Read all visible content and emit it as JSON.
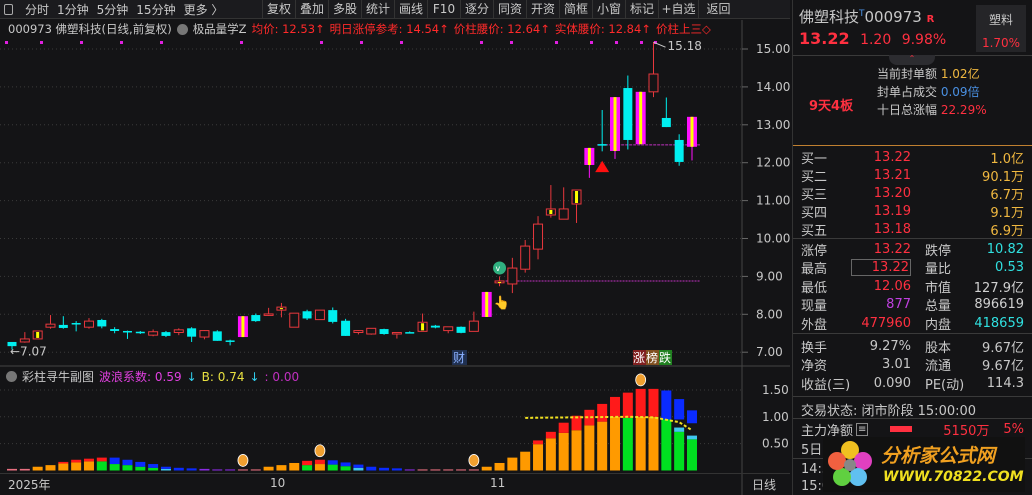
{
  "toolbar": {
    "left": [
      "分时",
      "1分钟",
      "5分钟",
      "15分钟",
      "更多 〉"
    ],
    "buttons": [
      "复权",
      "叠加",
      "多股",
      "统计",
      "画线",
      "F10",
      "逐分",
      "同资",
      "开资",
      "简框",
      "小窗",
      "标记",
      "+自选",
      "返回"
    ]
  },
  "info": {
    "title": "000973 佛塑科技(日线,前复权)",
    "indicator": "极品量学Z",
    "items": [
      "均价: 12.53↑",
      "明日涨停参考: 14.54↑",
      "价柱腰价: 12.64↑",
      "实体腰价: 12.84↑",
      "价柱上三◇"
    ]
  },
  "chart": {
    "price_ticks": [
      "15.00",
      "14.00",
      "13.00",
      "12.00",
      "11.00",
      "10.00",
      "9.00",
      "8.00",
      "7.00"
    ],
    "high_label": "15.18",
    "low_label": "←7.07",
    "tag_cai": "财",
    "tags": [
      "涨",
      "榜",
      "跌"
    ],
    "candles": [
      [
        7.27,
        7.27,
        7.07,
        7.16,
        "c"
      ],
      [
        7.27,
        7.53,
        7.25,
        7.35,
        "r"
      ],
      [
        7.35,
        7.56,
        7.35,
        7.56,
        "y"
      ],
      [
        7.66,
        7.98,
        7.62,
        7.74,
        "r"
      ],
      [
        7.72,
        7.95,
        7.62,
        7.64,
        "c"
      ],
      [
        7.77,
        7.82,
        7.55,
        7.76,
        "c"
      ],
      [
        7.66,
        7.9,
        7.62,
        7.82,
        "r"
      ],
      [
        7.85,
        7.88,
        7.63,
        7.68,
        "c"
      ],
      [
        7.61,
        7.66,
        7.5,
        7.56,
        "c"
      ],
      [
        7.56,
        7.57,
        7.35,
        7.55,
        "c"
      ],
      [
        7.54,
        7.56,
        7.48,
        7.5,
        "c"
      ],
      [
        7.45,
        7.6,
        7.42,
        7.54,
        "r"
      ],
      [
        7.53,
        7.56,
        7.4,
        7.43,
        "c"
      ],
      [
        7.52,
        7.63,
        7.45,
        7.59,
        "r"
      ],
      [
        7.63,
        7.66,
        7.27,
        7.41,
        "c"
      ],
      [
        7.4,
        7.58,
        7.34,
        7.57,
        "r"
      ],
      [
        7.55,
        7.58,
        7.3,
        7.3,
        "c"
      ],
      [
        7.31,
        7.33,
        7.18,
        7.28,
        "c"
      ],
      [
        7.4,
        7.95,
        7.4,
        7.95,
        "p"
      ],
      [
        7.98,
        8.02,
        7.8,
        7.82,
        "c"
      ],
      [
        7.98,
        8.17,
        7.96,
        8.01,
        "r"
      ],
      [
        8.11,
        8.3,
        7.92,
        8.19,
        "y"
      ],
      [
        7.66,
        8.03,
        7.66,
        8.03,
        "r"
      ],
      [
        8.08,
        8.12,
        7.85,
        7.89,
        "c"
      ],
      [
        7.86,
        8.11,
        7.86,
        8.11,
        "r"
      ],
      [
        8.11,
        8.18,
        7.76,
        7.8,
        "c"
      ],
      [
        7.83,
        7.88,
        7.43,
        7.43,
        "c"
      ],
      [
        7.52,
        7.58,
        7.47,
        7.57,
        "r"
      ],
      [
        7.48,
        7.63,
        7.46,
        7.63,
        "r"
      ],
      [
        7.61,
        7.62,
        7.46,
        7.48,
        "c"
      ],
      [
        7.48,
        7.52,
        7.36,
        7.52,
        "r"
      ],
      [
        7.53,
        7.55,
        7.51,
        7.53,
        "c"
      ],
      [
        7.55,
        8.02,
        7.55,
        7.79,
        "y"
      ],
      [
        7.7,
        7.72,
        7.63,
        7.65,
        "c"
      ],
      [
        7.57,
        7.67,
        7.5,
        7.67,
        "r"
      ],
      [
        7.67,
        7.68,
        7.5,
        7.51,
        "c"
      ],
      [
        7.55,
        8.07,
        7.55,
        7.82,
        "r"
      ],
      [
        7.93,
        8.59,
        7.93,
        8.59,
        "p"
      ],
      [
        8.83,
        9.0,
        8.74,
        8.88,
        "y"
      ],
      [
        8.8,
        9.49,
        8.56,
        9.22,
        "r"
      ],
      [
        9.19,
        9.96,
        9.1,
        9.8,
        "r"
      ],
      [
        9.72,
        10.59,
        9.45,
        10.38,
        "r"
      ],
      [
        10.62,
        11.41,
        10.55,
        10.78,
        "y"
      ],
      [
        10.51,
        11.35,
        10.51,
        10.78,
        "r"
      ],
      [
        10.91,
        11.28,
        10.41,
        11.28,
        "y"
      ],
      [
        11.94,
        12.39,
        11.6,
        12.39,
        "p"
      ],
      [
        12.49,
        13.39,
        12.3,
        12.49,
        "c"
      ],
      [
        12.31,
        13.73,
        12.1,
        13.73,
        "p"
      ],
      [
        13.97,
        14.3,
        12.35,
        12.6,
        "c"
      ],
      [
        12.49,
        13.87,
        12.49,
        13.87,
        "p"
      ],
      [
        13.87,
        15.18,
        13.73,
        14.34,
        "r"
      ],
      [
        13.18,
        13.72,
        12.94,
        12.94,
        "c"
      ],
      [
        12.6,
        12.75,
        11.92,
        12.02,
        "c"
      ],
      [
        12.42,
        13.21,
        12.06,
        13.21,
        "p"
      ]
    ],
    "line_levels": [
      8.88,
      12.47
    ]
  },
  "sub": {
    "title": "彩柱寻牛副图",
    "wave_label": "波浪系数: 0.59",
    "b_label": "B: 0.74",
    "c_label": ": 0.00",
    "ticks": [
      "1.50",
      "1.00",
      "0.50"
    ],
    "colors": {
      "o": "#ff9a00",
      "r": "#ff1a1a",
      "g": "#00e020",
      "b": "#0a2bff",
      "p": "#e87080",
      "u": "#8a2be2",
      "c": "#40c8f0"
    },
    "bars": [
      [
        [
          0,
          0.03,
          "p"
        ]
      ],
      [
        [
          0,
          0.03,
          "p"
        ]
      ],
      [
        [
          0,
          0.07,
          "o"
        ]
      ],
      [
        [
          0,
          0.1,
          "o"
        ]
      ],
      [
        [
          0,
          0.13,
          "o"
        ],
        [
          0.13,
          0.16,
          "r"
        ]
      ],
      [
        [
          0,
          0.15,
          "o"
        ],
        [
          0.15,
          0.2,
          "r"
        ]
      ],
      [
        [
          0,
          0.17,
          "o"
        ],
        [
          0.17,
          0.22,
          "r"
        ]
      ],
      [
        [
          0,
          0.17,
          "g"
        ],
        [
          0.17,
          0.24,
          "r"
        ]
      ],
      [
        [
          0,
          0.12,
          "g"
        ],
        [
          0.12,
          0.24,
          "b"
        ]
      ],
      [
        [
          0,
          0.1,
          "g"
        ],
        [
          0.1,
          0.2,
          "b"
        ]
      ],
      [
        [
          0,
          0.07,
          "g"
        ],
        [
          0.07,
          0.16,
          "b"
        ]
      ],
      [
        [
          0,
          0.05,
          "g"
        ],
        [
          0.05,
          0.12,
          "b"
        ]
      ],
      [
        [
          0,
          0.03,
          "c"
        ],
        [
          0.03,
          0.07,
          "b"
        ]
      ],
      [
        [
          0,
          0.05,
          "b"
        ]
      ],
      [
        [
          0,
          0.04,
          "b"
        ]
      ],
      [
        [
          0,
          0.03,
          "u"
        ]
      ],
      [
        [
          0,
          0.02,
          "u"
        ]
      ],
      [
        [
          0,
          0.02,
          "u"
        ]
      ],
      [
        [
          0,
          0.02,
          "p"
        ]
      ],
      [
        [
          0,
          0.02,
          "p"
        ]
      ],
      [
        [
          0,
          0.07,
          "o"
        ]
      ],
      [
        [
          0,
          0.1,
          "o"
        ]
      ],
      [
        [
          0,
          0.14,
          "o"
        ]
      ],
      [
        [
          0,
          0.1,
          "g"
        ],
        [
          0.1,
          0.18,
          "r"
        ]
      ],
      [
        [
          0,
          0.12,
          "o"
        ],
        [
          0.12,
          0.2,
          "r"
        ]
      ],
      [
        [
          0,
          0.11,
          "g"
        ],
        [
          0.11,
          0.19,
          "b"
        ]
      ],
      [
        [
          0,
          0.08,
          "g"
        ],
        [
          0.08,
          0.15,
          "b"
        ]
      ],
      [
        [
          0,
          0.05,
          "c"
        ],
        [
          0.05,
          0.11,
          "b"
        ]
      ],
      [
        [
          0,
          0.07,
          "b"
        ]
      ],
      [
        [
          0,
          0.05,
          "b"
        ]
      ],
      [
        [
          0,
          0.04,
          "b"
        ]
      ],
      [
        [
          0,
          0.02,
          "u"
        ]
      ],
      [
        [
          0,
          0.02,
          "p"
        ]
      ],
      [
        [
          0,
          0.02,
          "p"
        ]
      ],
      [
        [
          0,
          0.02,
          "p"
        ]
      ],
      [
        [
          0,
          0.02,
          "p"
        ]
      ],
      [
        [
          0,
          0.02,
          "p"
        ]
      ],
      [
        [
          0,
          0.07,
          "o"
        ]
      ],
      [
        [
          0,
          0.14,
          "o"
        ]
      ],
      [
        [
          0,
          0.24,
          "o"
        ]
      ],
      [
        [
          0,
          0.35,
          "o"
        ]
      ],
      [
        [
          0,
          0.49,
          "o"
        ],
        [
          0.49,
          0.56,
          "r"
        ]
      ],
      [
        [
          0,
          0.6,
          "o"
        ],
        [
          0.6,
          0.72,
          "r"
        ]
      ],
      [
        [
          0,
          0.7,
          "o"
        ],
        [
          0.7,
          0.89,
          "r"
        ]
      ],
      [
        [
          0,
          0.75,
          "o"
        ],
        [
          0.75,
          1.02,
          "r"
        ]
      ],
      [
        [
          0,
          0.84,
          "o"
        ],
        [
          0.84,
          1.13,
          "r"
        ]
      ],
      [
        [
          0,
          0.91,
          "o"
        ],
        [
          0.91,
          1.24,
          "r"
        ]
      ],
      [
        [
          0,
          1.0,
          "o"
        ],
        [
          1.0,
          1.37,
          "r"
        ]
      ],
      [
        [
          0,
          0.98,
          "g"
        ],
        [
          0.98,
          1.45,
          "r"
        ]
      ],
      [
        [
          0,
          1.0,
          "o"
        ],
        [
          1.0,
          1.52,
          "r"
        ]
      ],
      [
        [
          0,
          1.0,
          "o"
        ],
        [
          1.0,
          1.52,
          "r"
        ]
      ],
      [
        [
          0,
          0.95,
          "g"
        ],
        [
          0.95,
          1.49,
          "b"
        ]
      ],
      [
        [
          0,
          0.72,
          "g"
        ],
        [
          0.72,
          0.8,
          "c"
        ],
        [
          0.95,
          1.33,
          "b"
        ]
      ],
      [
        [
          0,
          0.58,
          "g"
        ],
        [
          0.58,
          0.65,
          "c"
        ],
        [
          0.88,
          1.12,
          "b"
        ]
      ]
    ],
    "moneybags": [
      18,
      24,
      36,
      49
    ]
  },
  "xaxis": {
    "labels": [
      "2025年",
      "10",
      "11"
    ],
    "right": "日线"
  },
  "quote": {
    "name": "佛塑科技",
    "t": "T",
    "code": "000973",
    "r": "R",
    "price": "13.22",
    "change": "1.20",
    "pct": "9.98%",
    "sector": "塑料",
    "sector_pct": "1.70%",
    "streak": "9天4板",
    "info": [
      {
        "label": "当前封单额",
        "value": "1.02亿"
      },
      {
        "label": "封单占成交",
        "value": "0.09倍"
      },
      {
        "label": "十日总涨幅",
        "value": "22.29%"
      }
    ],
    "book": [
      {
        "label": "买一",
        "price": "13.22",
        "vol": "1.0亿"
      },
      {
        "label": "买二",
        "price": "13.21",
        "vol": "90.1万"
      },
      {
        "label": "买三",
        "price": "13.20",
        "vol": "6.7万"
      },
      {
        "label": "买四",
        "price": "13.19",
        "vol": "9.1万"
      },
      {
        "label": "买五",
        "price": "13.18",
        "vol": "6.9万"
      }
    ],
    "stats": [
      [
        "涨停",
        "13.22",
        "跌停",
        "10.82"
      ],
      [
        "最高",
        "13.22",
        "量比",
        "0.53"
      ],
      [
        "最低",
        "12.06",
        "市值",
        "127.9亿"
      ],
      [
        "现量",
        "877",
        "总量",
        "896619"
      ],
      [
        "外盘",
        "477960",
        "内盘",
        "418659"
      ]
    ],
    "stats2": [
      [
        "换手",
        "9.27%",
        "股本",
        "9.67亿"
      ],
      [
        "净资",
        "3.01",
        "流通",
        "9.67亿"
      ],
      [
        "收益(三)",
        "0.090",
        "PE(动)",
        "114.3"
      ]
    ],
    "status": "交易状态: 闭市阶段 15:00:00",
    "main_label": "主力净额",
    "main_value": "5150万",
    "main_pct": "5%",
    "day5": "5日",
    "t1": "14:5",
    "t2": "15:0"
  },
  "watermark": {
    "text": "分析家公式网",
    "url": "WWW.70822.COM"
  }
}
